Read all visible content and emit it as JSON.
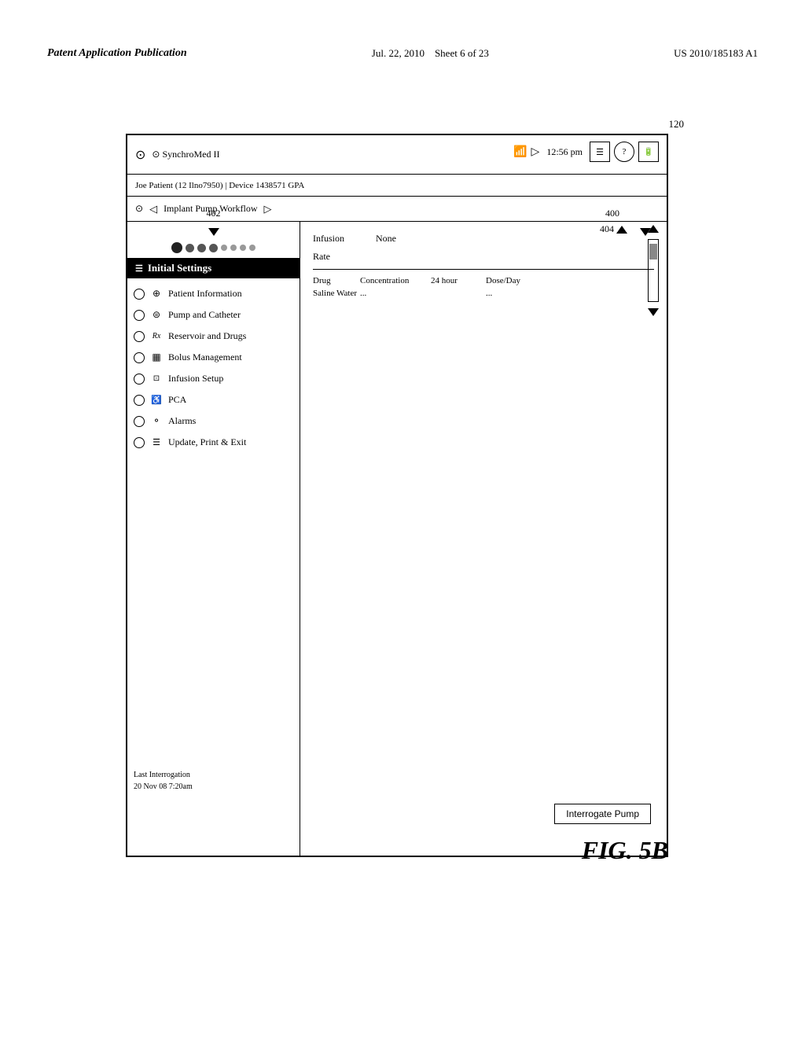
{
  "header": {
    "left": "Patent Application Publication",
    "center": "Jul. 22, 2010",
    "sheet": "Sheet 6 of 23",
    "right": "US 2010/185183 A1"
  },
  "label_120": "120",
  "device": {
    "sync_label": "⊙ SynchroMed II",
    "time": "12:56 pm",
    "patient_info": "Joe Patient (12 Ilno7950) | Device 1438571 GPA",
    "workflow": "Implant Pump Workflow",
    "label_402": "402",
    "label_400": "400",
    "label_404": "404",
    "initial_settings_header": "Initial Settings",
    "menu_items": [
      {
        "id": "initial-settings",
        "radio": "filled",
        "icon": "☰",
        "label": "Initial Settings"
      },
      {
        "id": "patient-information",
        "radio": "empty",
        "icon": "⊕",
        "label": "Patient Information"
      },
      {
        "id": "pump-catheter",
        "radio": "empty",
        "icon": "⊜",
        "label": "Pump and Catheter"
      },
      {
        "id": "reservoir-drugs",
        "radio": "empty",
        "icon": "Rx",
        "label": "Reservoir and Drugs"
      },
      {
        "id": "bolus-management",
        "radio": "empty",
        "icon": "▦",
        "label": "Bolus Management"
      },
      {
        "id": "infusion-setup",
        "radio": "empty",
        "icon": "⊡",
        "label": "Infusion Setup"
      },
      {
        "id": "pca",
        "radio": "empty",
        "icon": "♿",
        "label": "PCA"
      },
      {
        "id": "alarms",
        "radio": "empty",
        "icon": "⚪",
        "label": "Alarms"
      },
      {
        "id": "update-print",
        "radio": "empty",
        "icon": "☰",
        "label": "Update, Print & Exit"
      }
    ],
    "right_panel": {
      "infusion_label": "Infusion",
      "infusion_value": "None",
      "rate_label": "Rate",
      "drug_label": "Drug",
      "drug_value": "Saline Water",
      "concentration_label": "Concentration",
      "concentration_value": "...",
      "24hour_label": "24 hour",
      "dose_day_label": "Dose/Day",
      "dose_day_value": "..."
    },
    "last_interrogation": "Last Interrogation\n20 Nov 08 7:20am",
    "interrogate_button": "Interrogate Pump"
  },
  "fig_label": "FIG. 5B"
}
